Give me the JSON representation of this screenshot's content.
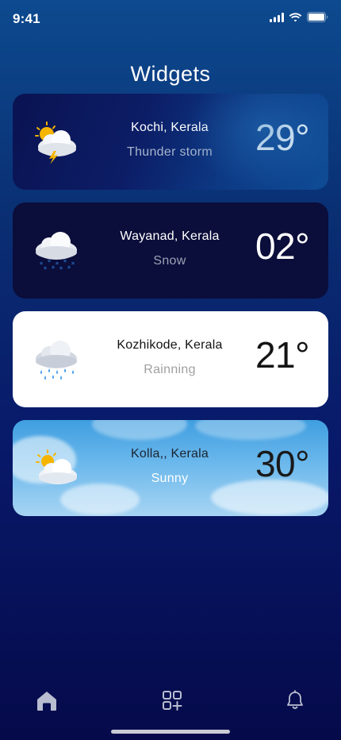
{
  "status_bar": {
    "time": "9:41"
  },
  "page": {
    "title": "Widgets"
  },
  "cards": [
    {
      "city": "Kochi, Kerala",
      "condition": "Thunder storm",
      "temperature": "29°",
      "icon": "thunderstorm-icon"
    },
    {
      "city": "Wayanad, Kerala",
      "condition": "Snow",
      "temperature": "02°",
      "icon": "snow-icon"
    },
    {
      "city": "Kozhikode, Kerala",
      "condition": "Rainning",
      "temperature": "21°",
      "icon": "rain-icon"
    },
    {
      "city": "Kolla,, Kerala",
      "condition": "Sunny",
      "temperature": "30°",
      "icon": "sun-cloud-icon"
    }
  ],
  "tab_bar": {
    "items": [
      "home-icon",
      "add-widget-icon",
      "bell-icon"
    ],
    "active_color": "#b8bdd0"
  }
}
